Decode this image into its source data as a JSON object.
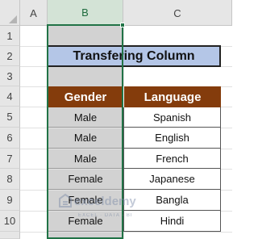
{
  "columns": [
    "A",
    "B",
    "C"
  ],
  "rows": [
    "1",
    "2",
    "3",
    "4",
    "5",
    "6",
    "7",
    "8",
    "9",
    "10"
  ],
  "title": "Transfering Column",
  "table": {
    "headers": [
      "Gender",
      "Language"
    ],
    "rows": [
      [
        "Male",
        "Spanish"
      ],
      [
        "Male",
        "English"
      ],
      [
        "Male",
        "French"
      ],
      [
        "Female",
        "Japanese"
      ],
      [
        "Female",
        "Bangla"
      ],
      [
        "Female",
        "Hindi"
      ]
    ]
  },
  "watermark": {
    "name": "exceldemy",
    "tagline": "EXCEL · DATA · BI"
  },
  "colors": {
    "title_fill": "#b4c6e7",
    "header_fill": "#843c0c",
    "selection": "#217346"
  }
}
